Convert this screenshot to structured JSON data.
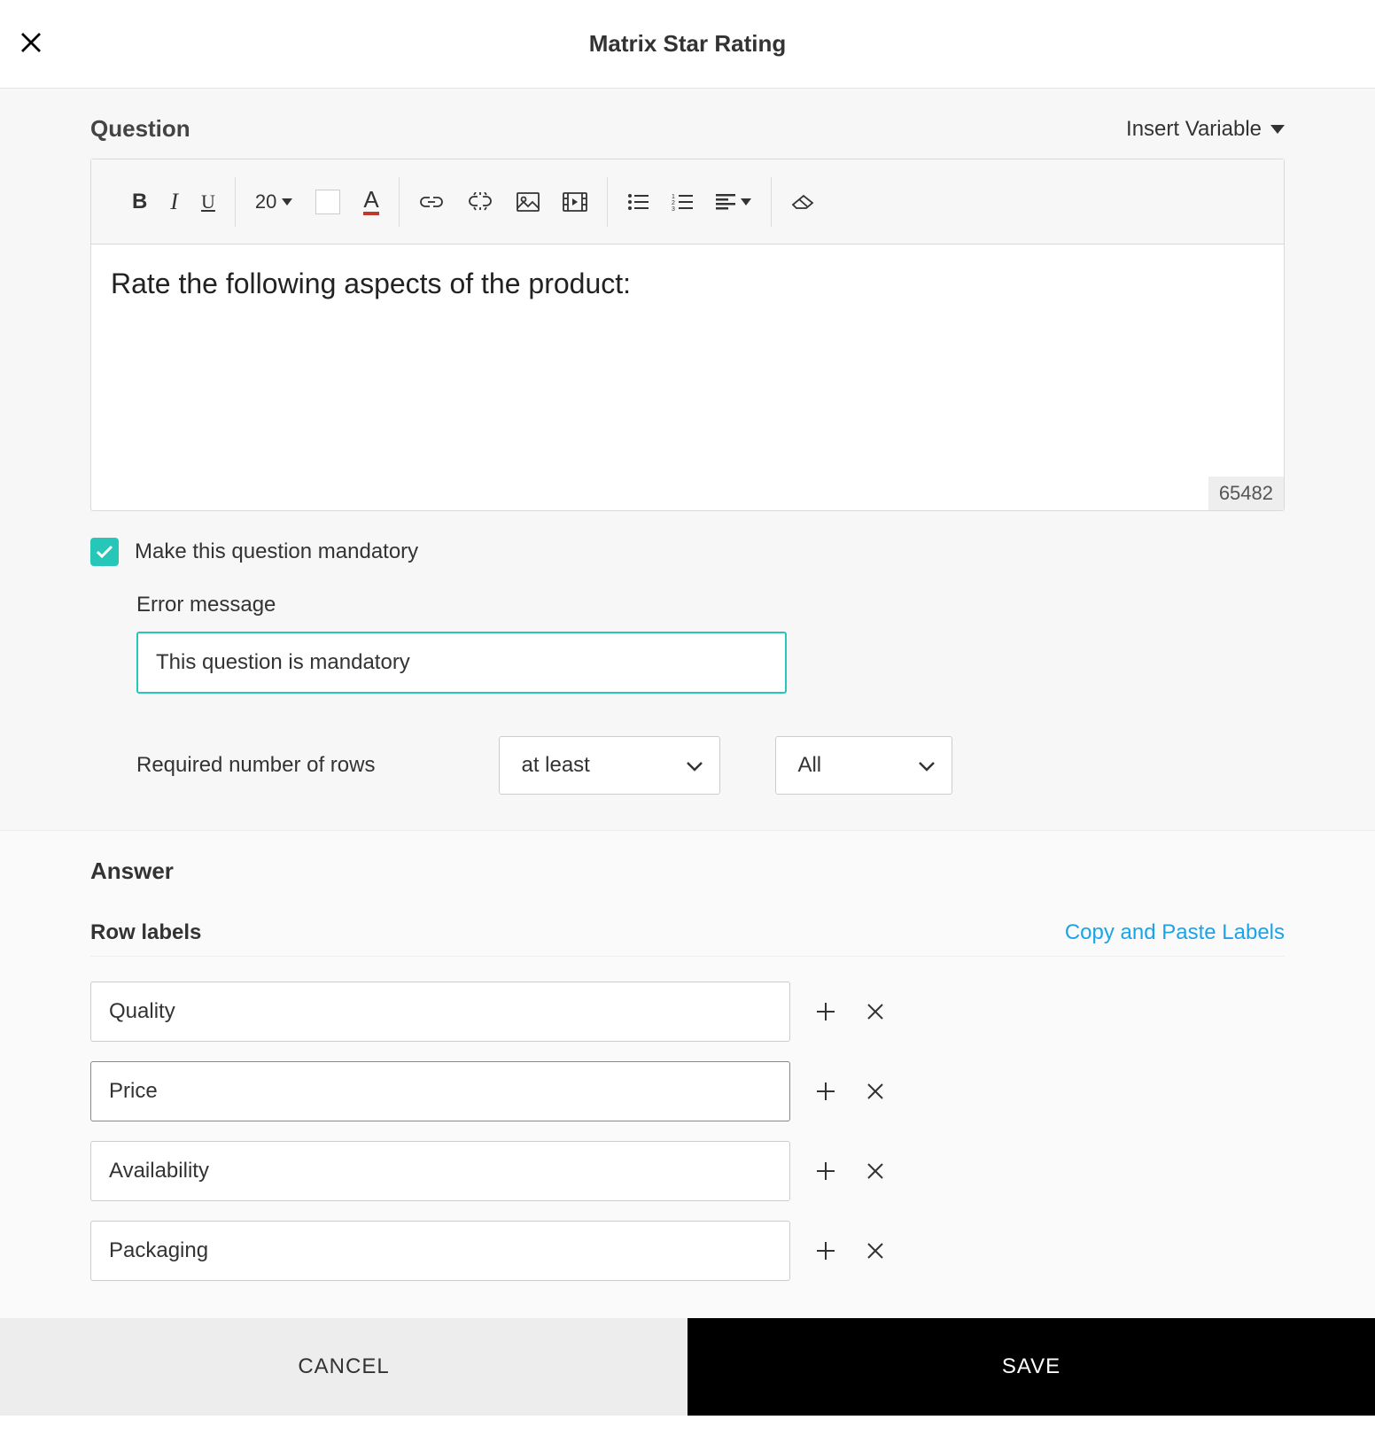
{
  "header": {
    "title": "Matrix Star Rating"
  },
  "question": {
    "section_label": "Question",
    "insert_variable_label": "Insert Variable",
    "toolbar": {
      "font_size": "20"
    },
    "text": "Rate the following aspects of the product:",
    "char_count": "65482"
  },
  "mandatory": {
    "label": "Make this question mandatory",
    "error_label": "Error message",
    "error_value": "This question is mandatory",
    "required_rows_label": "Required number of rows",
    "select1": "at least",
    "select2": "All"
  },
  "answer": {
    "section_label": "Answer",
    "row_labels_title": "Row labels",
    "copy_paste_label": "Copy and Paste Labels",
    "rows": [
      {
        "label": "Quality"
      },
      {
        "label": "Price"
      },
      {
        "label": "Availability"
      },
      {
        "label": "Packaging"
      }
    ]
  },
  "footer": {
    "cancel": "CANCEL",
    "save": "SAVE"
  }
}
